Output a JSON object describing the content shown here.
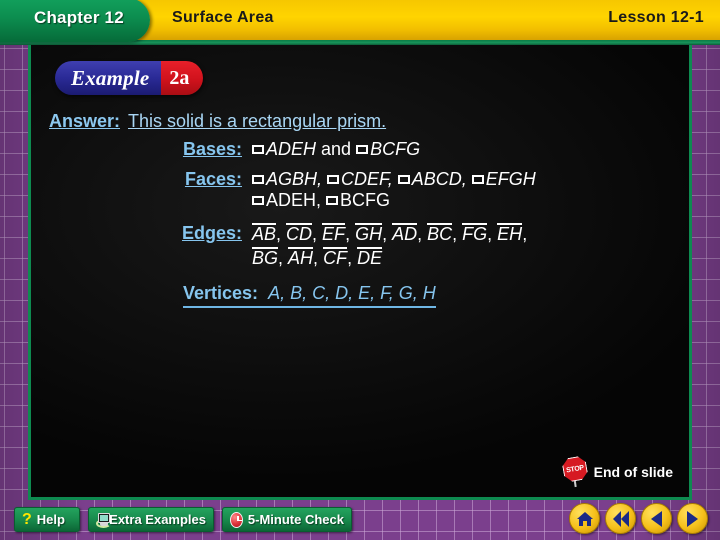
{
  "header": {
    "chapter": "Chapter 12",
    "subject": "Surface Area",
    "lesson": "Lesson 12-1"
  },
  "badge": {
    "word": "Example",
    "number": "2a"
  },
  "answer": {
    "label": "Answer:",
    "sentence": "This solid is a rectangular prism.",
    "rows": [
      {
        "label": "Bases:",
        "value": "▭ADEH and ▭BCFG"
      },
      {
        "label": "Faces:",
        "value": "▭AGBH, ▭CDEF, ▭ABCD, ▭EFGH",
        "value2": "▭ADEH, ▭BCFG"
      },
      {
        "label": "Edges:",
        "value": "AB, CD, EF, GH, AD, BC, FG, EH,",
        "value2": "BG, AH, CF, DE"
      }
    ],
    "bases_parts": [
      "ADEH",
      "and",
      "BCFG"
    ],
    "faces_line1": [
      "AGBH,",
      "CDEF,",
      "ABCD,",
      "EFGH"
    ],
    "faces_line2": [
      "ADEH,",
      "BCFG"
    ],
    "edges_line1": [
      "AB",
      "CD",
      "EF",
      "GH",
      "AD",
      "BC",
      "FG",
      "EH"
    ],
    "edges_line2": [
      "BG",
      "AH",
      "CF",
      "DE"
    ],
    "vertices_label": "Vertices:",
    "vertices_value": "A, B, C, D, E, F, G, H"
  },
  "end_of_slide": {
    "icon": "stop-sign-icon",
    "stop_text": "STOP",
    "label": "End of slide"
  },
  "toolbar": {
    "buttons": [
      {
        "label": "Help",
        "icon": "question-mark-icon"
      },
      {
        "label": "Extra Examples",
        "icon": "monitor-icon"
      },
      {
        "label": "5-Minute Check",
        "icon": "clock-icon"
      }
    ],
    "nav": [
      {
        "name": "home-icon"
      },
      {
        "name": "double-back-icon"
      },
      {
        "name": "back-icon"
      },
      {
        "name": "forward-icon"
      }
    ]
  },
  "colors": {
    "header_yellow": "#ffd400",
    "tab_green": "#0c8d4f",
    "frame_green": "#0e8a50",
    "border_purple": "#7b3f8d",
    "accent_blue": "#86c5ee",
    "button_green": "#17884b",
    "nav_yellow": "#f5c01a",
    "badge_blue": "#2a2a96",
    "badge_red": "#d0121c"
  }
}
